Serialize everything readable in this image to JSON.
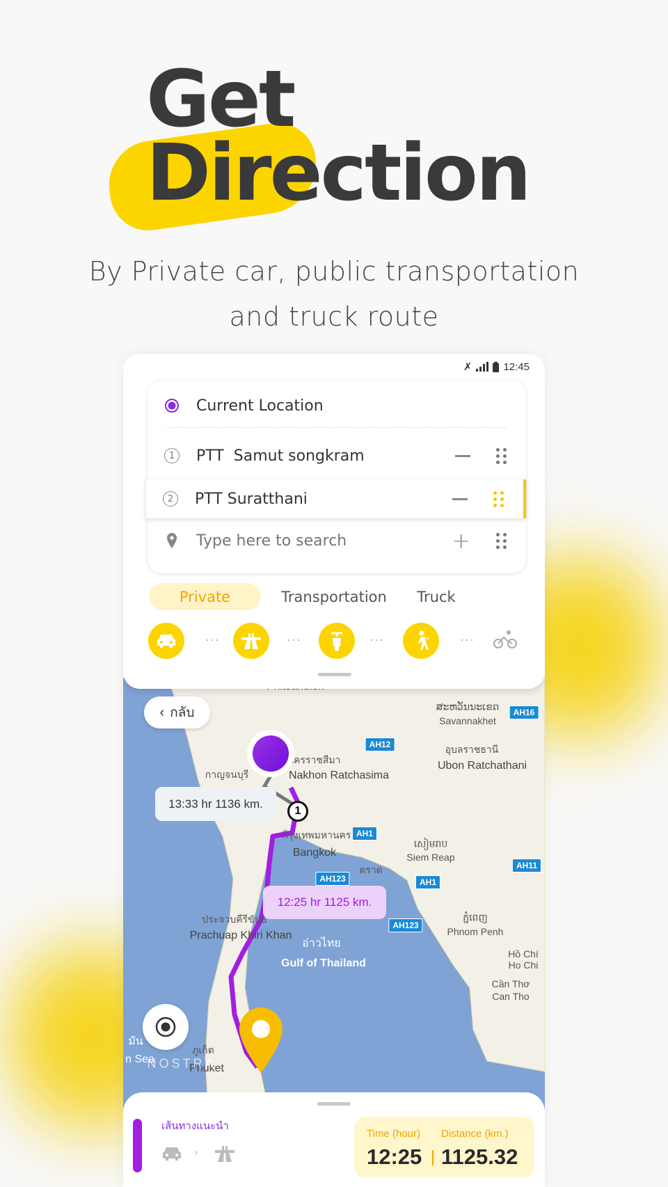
{
  "hero": {
    "line1": "Get",
    "line2": "Direction",
    "subtitle_line1": "By Private car, public transportation",
    "subtitle_line2": "and truck route"
  },
  "colors": {
    "accent_yellow": "#fcd500",
    "route_purple": "#a21ee0",
    "sea": "#7fa3d5",
    "land": "#f3f0e7"
  },
  "status_bar": {
    "time": "12:45",
    "icons": [
      "mute-icon",
      "signal-icon",
      "battery-icon"
    ]
  },
  "route_inputs": {
    "origin": "Current Location",
    "stops": [
      {
        "index": "1",
        "name": "PTT  Samut songkram"
      },
      {
        "index": "2",
        "name": "PTT Suratthani"
      }
    ],
    "search_placeholder": "Type here to search"
  },
  "tabs": [
    {
      "label": "Private",
      "active": true
    },
    {
      "label": "Transportation",
      "active": false
    },
    {
      "label": "Truck",
      "active": false
    }
  ],
  "modes": [
    "car-icon",
    "highway-icon",
    "motorbike-icon",
    "walk-icon",
    "bicycle-icon"
  ],
  "map": {
    "back_label": "กลับ",
    "route_tip_alt": "13:33 hr 1136 km.",
    "route_tip_main": "12:25 hr 1125 km.",
    "waypoint_marker": "1",
    "watermark": "NOSTRA",
    "labels": {
      "phitsanulok": "Phitsanulok",
      "savannakhet_lo": "ສະຫວັນນະເຂດ",
      "savannakhet": "Savannakhet",
      "nakhon_th": "นครราชสีมา",
      "nakhon": "Nakhon Ratchasima",
      "ubon_th": "อุบลราชธานี",
      "ubon": "Ubon Ratchathani",
      "kanchanaburi_th": "กาญจนบุรี",
      "bangkok_th": "กรุงเทพมหานคร",
      "bangkok": "Bangkok",
      "siemreap_km": "សៀមរាប",
      "siemreap": "Siem Reap",
      "trat_th": "ตราด",
      "phnompenh_km": "ភ្នំពេញ",
      "phnompenh": "Phnom Penh",
      "prachuap_th": "ประจวบคีรีขันธ์",
      "prachuap": "Prachuap Khiri Khan",
      "gulf_th": "อ่าวไทย",
      "gulf": "Gulf of Thailand",
      "hochiminh_vi": "Hồ Chí",
      "hochiminh": "Ho Chi",
      "cantho_vi": "Cần Thơ",
      "cantho": "Can Tho",
      "phuket_th": "ภูเก็ต",
      "phuket": "Phuket",
      "andaman": "n Sea",
      "andaman_th": "มัน"
    },
    "highways": {
      "ah16": "AH16",
      "ah12": "AH12",
      "ah1a": "AH1",
      "ah11": "AH11",
      "ah1b": "AH1",
      "ah123a": "AH123",
      "ah123b": "AH123"
    }
  },
  "summary": {
    "route_label": "เส้นทางแนะนำ",
    "time_label": "Time (hour)",
    "time_value": "12:25",
    "distance_label": "Distance (km.)",
    "distance_value": "1125.32"
  }
}
